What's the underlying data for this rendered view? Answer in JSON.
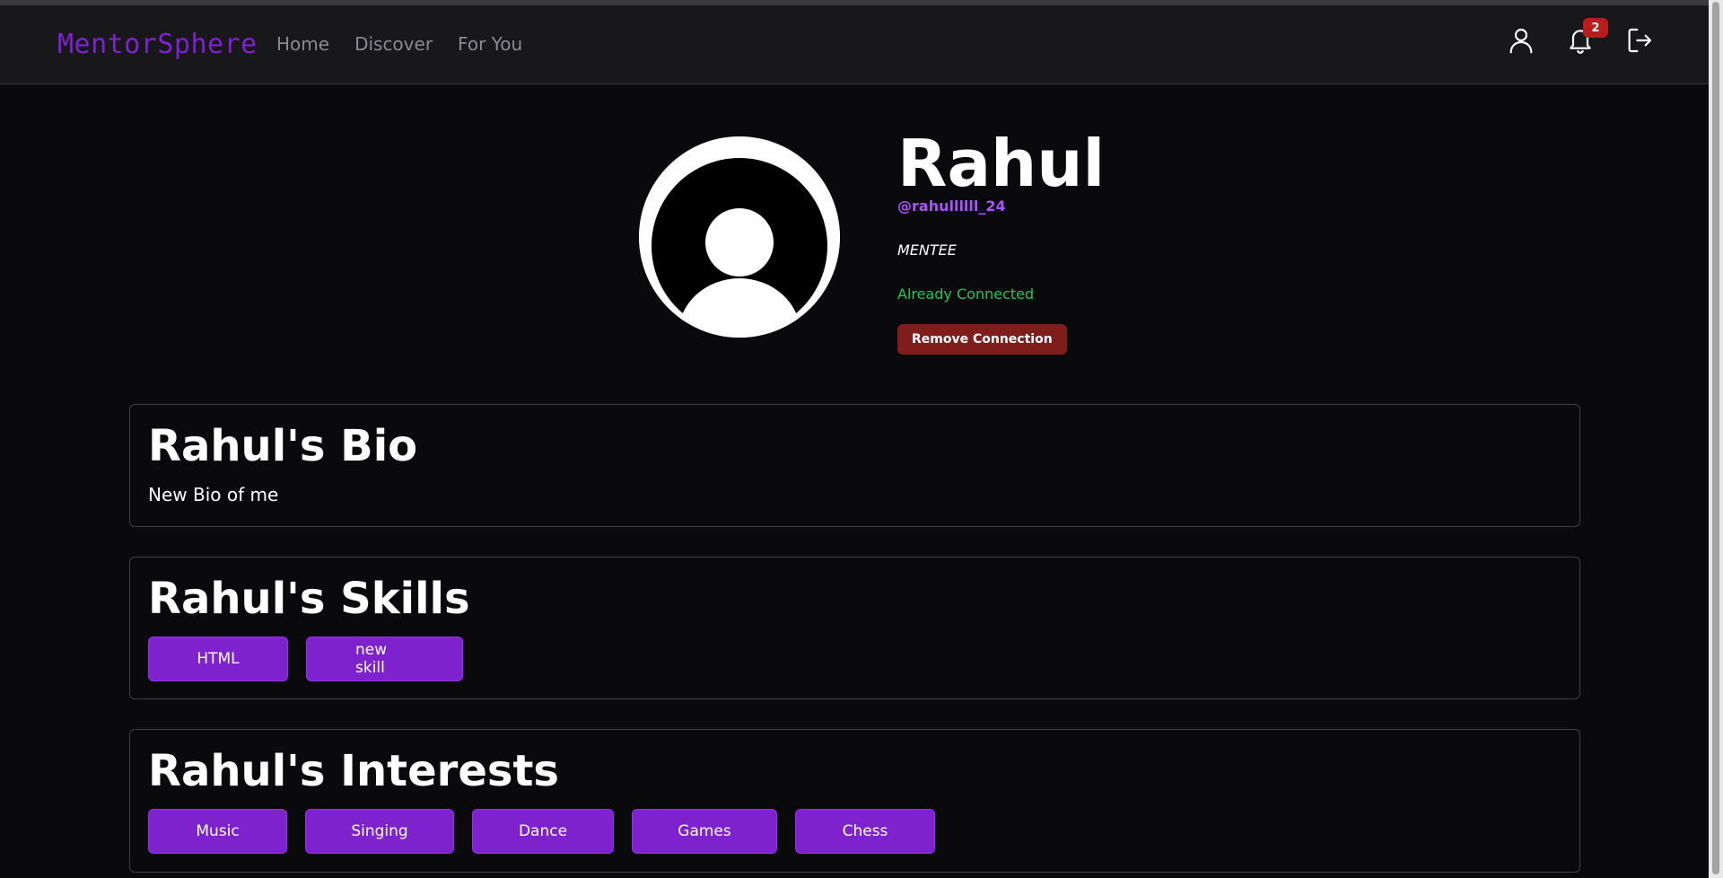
{
  "nav": {
    "brand": "MentorSphere",
    "links": [
      "Home",
      "Discover",
      "For You"
    ],
    "notification_count": "2",
    "icons": [
      "user-icon",
      "bell-icon",
      "logout-icon"
    ]
  },
  "profile": {
    "name": "Rahul",
    "username": "@rahullllll_24",
    "role": "MENTEE",
    "status": "Already Connected",
    "remove_button": "Remove Connection",
    "avatar_icon": "default-avatar-icon"
  },
  "bio": {
    "title": "Rahul's Bio",
    "text": "New Bio of me"
  },
  "skills": {
    "title": "Rahul's Skills",
    "items": [
      "HTML",
      "new skill"
    ]
  },
  "interests": {
    "title": "Rahul's Interests",
    "items": [
      "Music",
      "Singing",
      "Dance",
      "Games",
      "Chess"
    ]
  },
  "colors": {
    "brand": "#7e22ce",
    "username": "#a855f7",
    "status": "#22c55e",
    "danger": "#7f1d1d",
    "tag": "#7e22ce",
    "background": "#0a0a0c",
    "navbar": "#18181b"
  }
}
